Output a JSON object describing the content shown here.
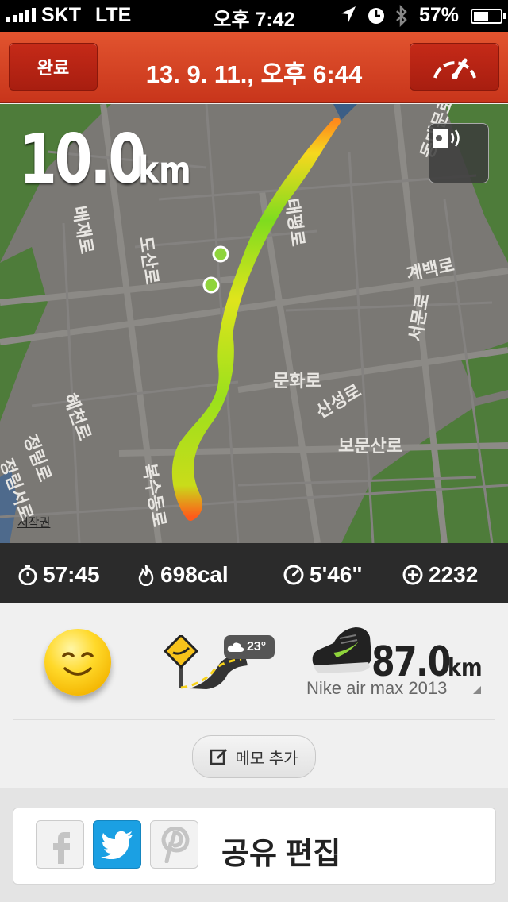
{
  "status_bar": {
    "carrier": "SKT",
    "network": "LTE",
    "time": "오후 7:42",
    "battery": "57%"
  },
  "header": {
    "done_label": "완료",
    "title": "13. 9. 11., 오후 6:44"
  },
  "map": {
    "distance_value": "10.0",
    "distance_unit": "km",
    "copyright": "저작권",
    "street_labels": [
      "동대문로",
      "배재로",
      "도산로",
      "태평로",
      "계백로",
      "문화로",
      "산성로",
      "서문로",
      "보문산로",
      "혜천로",
      "정림로",
      "정림서로",
      "복수동로"
    ]
  },
  "stats": {
    "duration": "57:45",
    "calories": "698cal",
    "pace": "5'46\"",
    "fuel": "2232"
  },
  "summary": {
    "weather_temp": "23°",
    "shoe_distance_value": "87.0",
    "shoe_distance_unit": "km",
    "shoe_name": "Nike air max 2013",
    "memo_label": "메모 추가"
  },
  "share": {
    "label": "공유 편집"
  },
  "colors": {
    "header_red": "#d3401f",
    "twitter_blue": "#1ba0e3",
    "stats_bg": "#2b2b2b",
    "park_green": "#4e7c3a"
  }
}
